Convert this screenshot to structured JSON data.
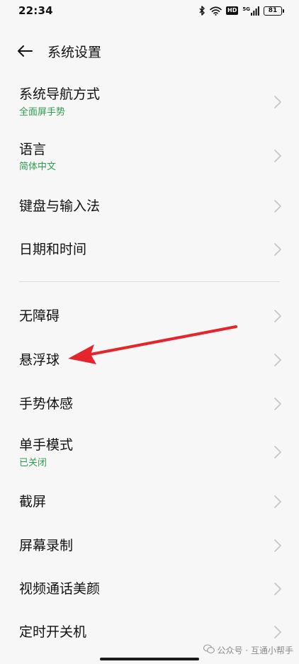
{
  "status_bar": {
    "time": "22:34",
    "network_badge": "HD",
    "signal_label": "5G",
    "battery_level": "81",
    "icons": [
      "bluetooth-icon",
      "wifi-icon",
      "hd-icon",
      "signal-icon",
      "battery-icon"
    ]
  },
  "header": {
    "title": "系统设置",
    "back_icon": "arrow-left-icon"
  },
  "settings": {
    "items": [
      {
        "title": "系统导航方式",
        "subtitle": "全面屏手势"
      },
      {
        "title": "语言",
        "subtitle": "简体中文"
      },
      {
        "title": "键盘与输入法"
      },
      {
        "title": "日期和时间"
      },
      {
        "title": "无障碍"
      },
      {
        "title": "悬浮球"
      },
      {
        "title": "手势体感"
      },
      {
        "title": "单手模式",
        "subtitle": "已关闭"
      },
      {
        "title": "截屏"
      },
      {
        "title": "屏幕录制"
      },
      {
        "title": "视频通话美颜"
      },
      {
        "title": "定时开关机"
      }
    ]
  },
  "watermark": {
    "text": "公众号 · 互通小帮手",
    "icon": "wechat-icon"
  },
  "colors": {
    "subtitle": "#2e9e4f",
    "annotation": "#e5252b",
    "background": "#f7f7f7"
  }
}
